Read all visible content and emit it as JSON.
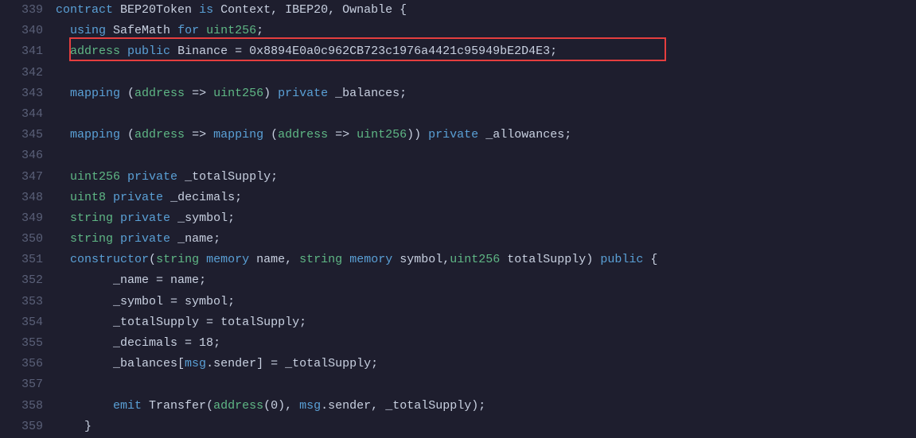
{
  "lines": [
    {
      "num": "339",
      "indent": 0,
      "tokens": [
        {
          "t": "contract",
          "c": "kw-blue"
        },
        {
          "t": " ",
          "c": "text"
        },
        {
          "t": "BEP20Token",
          "c": "identifier"
        },
        {
          "t": " ",
          "c": "text"
        },
        {
          "t": "is",
          "c": "kw-blue"
        },
        {
          "t": " ",
          "c": "text"
        },
        {
          "t": "Context",
          "c": "identifier"
        },
        {
          "t": ", ",
          "c": "punct"
        },
        {
          "t": "IBEP20",
          "c": "identifier"
        },
        {
          "t": ", ",
          "c": "punct"
        },
        {
          "t": "Ownable",
          "c": "identifier"
        },
        {
          "t": " {",
          "c": "punct"
        }
      ]
    },
    {
      "num": "340",
      "indent": 1,
      "tokens": [
        {
          "t": "using",
          "c": "kw-blue"
        },
        {
          "t": " ",
          "c": "text"
        },
        {
          "t": "SafeMath",
          "c": "identifier"
        },
        {
          "t": " ",
          "c": "text"
        },
        {
          "t": "for",
          "c": "kw-blue"
        },
        {
          "t": " ",
          "c": "text"
        },
        {
          "t": "uint256",
          "c": "kw-green"
        },
        {
          "t": ";",
          "c": "punct"
        }
      ]
    },
    {
      "num": "341",
      "indent": 1,
      "tokens": [
        {
          "t": "address",
          "c": "kw-green"
        },
        {
          "t": " ",
          "c": "text"
        },
        {
          "t": "public",
          "c": "kw-blue"
        },
        {
          "t": " ",
          "c": "text"
        },
        {
          "t": "Binance",
          "c": "identifier"
        },
        {
          "t": " = ",
          "c": "punct"
        },
        {
          "t": "0x8894E0a0c962CB723c1976a4421c95949bE2D4E3",
          "c": "addr"
        },
        {
          "t": ";",
          "c": "punct"
        }
      ]
    },
    {
      "num": "342",
      "indent": 0,
      "tokens": []
    },
    {
      "num": "343",
      "indent": 1,
      "tokens": [
        {
          "t": "mapping",
          "c": "kw-blue"
        },
        {
          "t": " (",
          "c": "punct"
        },
        {
          "t": "address",
          "c": "kw-green"
        },
        {
          "t": " => ",
          "c": "punct"
        },
        {
          "t": "uint256",
          "c": "kw-green"
        },
        {
          "t": ") ",
          "c": "punct"
        },
        {
          "t": "private",
          "c": "kw-blue"
        },
        {
          "t": " ",
          "c": "text"
        },
        {
          "t": "_balances",
          "c": "identifier"
        },
        {
          "t": ";",
          "c": "punct"
        }
      ]
    },
    {
      "num": "344",
      "indent": 0,
      "tokens": []
    },
    {
      "num": "345",
      "indent": 1,
      "tokens": [
        {
          "t": "mapping",
          "c": "kw-blue"
        },
        {
          "t": " (",
          "c": "punct"
        },
        {
          "t": "address",
          "c": "kw-green"
        },
        {
          "t": " => ",
          "c": "punct"
        },
        {
          "t": "mapping",
          "c": "kw-blue"
        },
        {
          "t": " (",
          "c": "punct"
        },
        {
          "t": "address",
          "c": "kw-green"
        },
        {
          "t": " => ",
          "c": "punct"
        },
        {
          "t": "uint256",
          "c": "kw-green"
        },
        {
          "t": ")) ",
          "c": "punct"
        },
        {
          "t": "private",
          "c": "kw-blue"
        },
        {
          "t": " ",
          "c": "text"
        },
        {
          "t": "_allowances",
          "c": "identifier"
        },
        {
          "t": ";",
          "c": "punct"
        }
      ]
    },
    {
      "num": "346",
      "indent": 0,
      "tokens": []
    },
    {
      "num": "347",
      "indent": 1,
      "tokens": [
        {
          "t": "uint256",
          "c": "kw-green"
        },
        {
          "t": " ",
          "c": "text"
        },
        {
          "t": "private",
          "c": "kw-blue"
        },
        {
          "t": " ",
          "c": "text"
        },
        {
          "t": "_totalSupply",
          "c": "identifier"
        },
        {
          "t": ";",
          "c": "punct"
        }
      ]
    },
    {
      "num": "348",
      "indent": 1,
      "tokens": [
        {
          "t": "uint8",
          "c": "kw-green"
        },
        {
          "t": " ",
          "c": "text"
        },
        {
          "t": "private",
          "c": "kw-blue"
        },
        {
          "t": " ",
          "c": "text"
        },
        {
          "t": "_decimals",
          "c": "identifier"
        },
        {
          "t": ";",
          "c": "punct"
        }
      ]
    },
    {
      "num": "349",
      "indent": 1,
      "tokens": [
        {
          "t": "string",
          "c": "kw-green"
        },
        {
          "t": " ",
          "c": "text"
        },
        {
          "t": "private",
          "c": "kw-blue"
        },
        {
          "t": " ",
          "c": "text"
        },
        {
          "t": "_symbol",
          "c": "identifier"
        },
        {
          "t": ";",
          "c": "punct"
        }
      ]
    },
    {
      "num": "350",
      "indent": 1,
      "tokens": [
        {
          "t": "string",
          "c": "kw-green"
        },
        {
          "t": " ",
          "c": "text"
        },
        {
          "t": "private",
          "c": "kw-blue"
        },
        {
          "t": " ",
          "c": "text"
        },
        {
          "t": "_name",
          "c": "identifier"
        },
        {
          "t": ";",
          "c": "punct"
        }
      ]
    },
    {
      "num": "351",
      "indent": 1,
      "tokens": [
        {
          "t": "constructor",
          "c": "kw-blue"
        },
        {
          "t": "(",
          "c": "punct"
        },
        {
          "t": "string",
          "c": "kw-green"
        },
        {
          "t": " ",
          "c": "text"
        },
        {
          "t": "memory",
          "c": "kw-blue"
        },
        {
          "t": " ",
          "c": "text"
        },
        {
          "t": "name",
          "c": "identifier"
        },
        {
          "t": ", ",
          "c": "punct"
        },
        {
          "t": "string",
          "c": "kw-green"
        },
        {
          "t": " ",
          "c": "text"
        },
        {
          "t": "memory",
          "c": "kw-blue"
        },
        {
          "t": " ",
          "c": "text"
        },
        {
          "t": "symbol",
          "c": "identifier"
        },
        {
          "t": ",",
          "c": "punct"
        },
        {
          "t": "uint256",
          "c": "kw-green"
        },
        {
          "t": " ",
          "c": "text"
        },
        {
          "t": "totalSupply",
          "c": "identifier"
        },
        {
          "t": ") ",
          "c": "punct"
        },
        {
          "t": "public",
          "c": "kw-blue"
        },
        {
          "t": " {",
          "c": "punct"
        }
      ]
    },
    {
      "num": "352",
      "indent": 3,
      "tokens": [
        {
          "t": "_name",
          "c": "identifier"
        },
        {
          "t": " = ",
          "c": "punct"
        },
        {
          "t": "name",
          "c": "identifier"
        },
        {
          "t": ";",
          "c": "punct"
        }
      ]
    },
    {
      "num": "353",
      "indent": 3,
      "tokens": [
        {
          "t": "_symbol",
          "c": "identifier"
        },
        {
          "t": " = ",
          "c": "punct"
        },
        {
          "t": "symbol",
          "c": "identifier"
        },
        {
          "t": ";",
          "c": "punct"
        }
      ]
    },
    {
      "num": "354",
      "indent": 3,
      "tokens": [
        {
          "t": "_totalSupply",
          "c": "identifier"
        },
        {
          "t": " = ",
          "c": "punct"
        },
        {
          "t": "totalSupply",
          "c": "identifier"
        },
        {
          "t": ";",
          "c": "punct"
        }
      ]
    },
    {
      "num": "355",
      "indent": 3,
      "tokens": [
        {
          "t": "_decimals",
          "c": "identifier"
        },
        {
          "t": " = ",
          "c": "punct"
        },
        {
          "t": "18",
          "c": "number"
        },
        {
          "t": ";",
          "c": "punct"
        }
      ]
    },
    {
      "num": "356",
      "indent": 3,
      "tokens": [
        {
          "t": "_balances",
          "c": "identifier"
        },
        {
          "t": "[",
          "c": "punct"
        },
        {
          "t": "msg",
          "c": "msg"
        },
        {
          "t": ".sender",
          "c": "identifier"
        },
        {
          "t": "] = ",
          "c": "punct"
        },
        {
          "t": "_totalSupply",
          "c": "identifier"
        },
        {
          "t": ";",
          "c": "punct"
        }
      ]
    },
    {
      "num": "357",
      "indent": 0,
      "tokens": []
    },
    {
      "num": "358",
      "indent": 3,
      "tokens": [
        {
          "t": "emit",
          "c": "kw-blue"
        },
        {
          "t": " ",
          "c": "text"
        },
        {
          "t": "Transfer",
          "c": "func"
        },
        {
          "t": "(",
          "c": "punct"
        },
        {
          "t": "address",
          "c": "kw-green"
        },
        {
          "t": "(",
          "c": "punct"
        },
        {
          "t": "0",
          "c": "number"
        },
        {
          "t": "), ",
          "c": "punct"
        },
        {
          "t": "msg",
          "c": "msg"
        },
        {
          "t": ".sender",
          "c": "identifier"
        },
        {
          "t": ", ",
          "c": "punct"
        },
        {
          "t": "_totalSupply",
          "c": "identifier"
        },
        {
          "t": ");",
          "c": "punct"
        }
      ]
    },
    {
      "num": "359",
      "indent": 2,
      "tokens": [
        {
          "t": "}",
          "c": "punct"
        }
      ]
    }
  ]
}
